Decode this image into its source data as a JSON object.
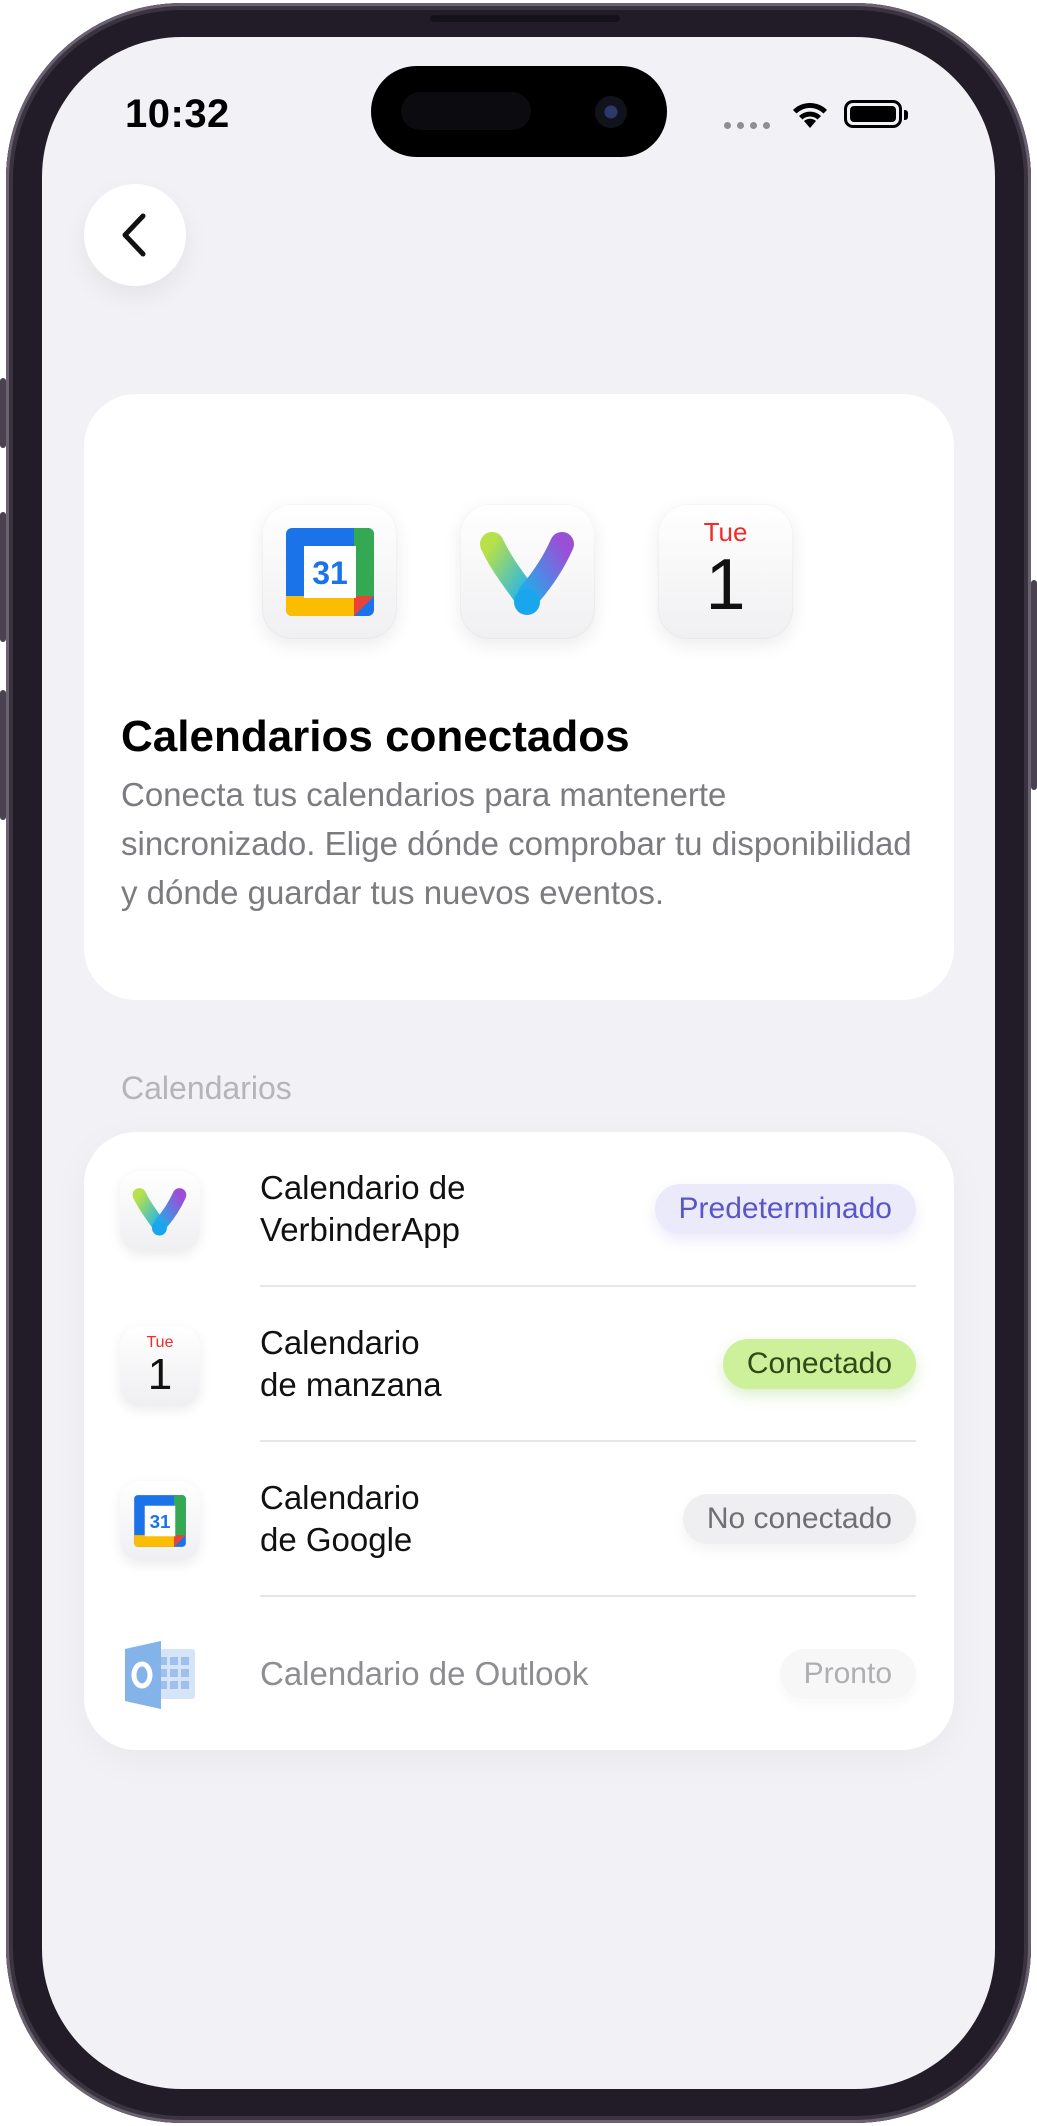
{
  "status_bar": {
    "time": "10:32"
  },
  "hero": {
    "title": "Calendarios conectados",
    "description": "Conecta tus calendarios para mantenerte sincronizado. Elige dónde comprobar tu disponibilidad y dónde guardar tus nuevos eventos.",
    "icons": {
      "google": {
        "number": "31"
      },
      "apple": {
        "day": "Tue",
        "number": "1"
      }
    }
  },
  "section": {
    "label": "Calendarios"
  },
  "calendars": [
    {
      "title_line1": "Calendario de",
      "title_line2": "VerbinderApp",
      "badge": "Predeterminado"
    },
    {
      "title_line1": "Calendario",
      "title_line2": "de manzana",
      "badge": "Conectado",
      "icon_day": "Tue",
      "icon_number": "1"
    },
    {
      "title_line1": "Calendario",
      "title_line2": "de Google",
      "badge": "No conectado",
      "icon_number": "31"
    },
    {
      "title": "Calendario de Outlook",
      "badge": "Pronto"
    }
  ],
  "colors": {
    "background": "#f2f1f6",
    "badge_default": "#5b56c8",
    "badge_connected": "#cdf09a",
    "apple_red": "#f22a2a"
  }
}
